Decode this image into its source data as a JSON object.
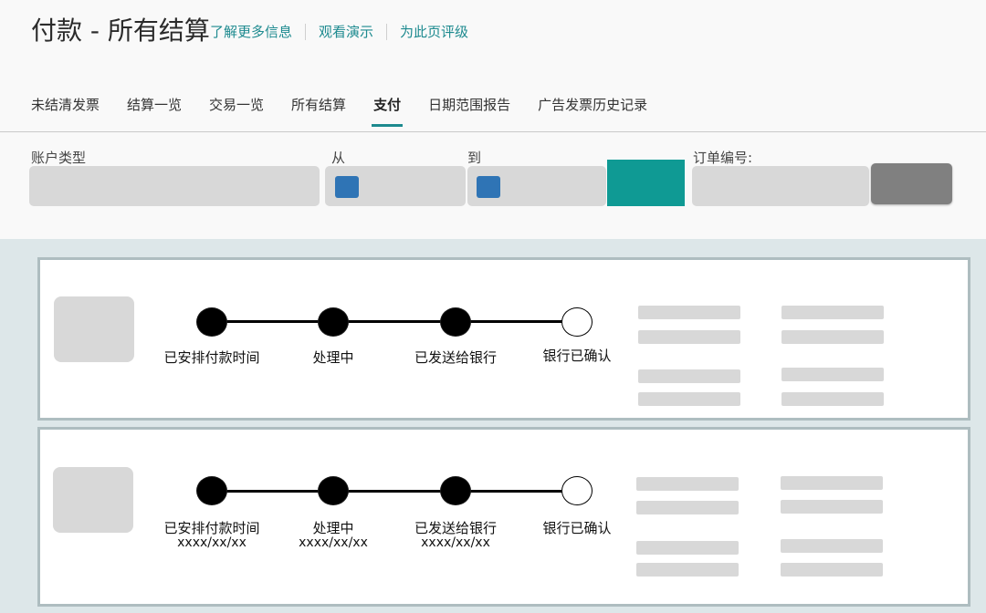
{
  "header": {
    "title": "付款 - 所有结算",
    "links": [
      "了解更多信息",
      "观看演示",
      "为此页评级"
    ]
  },
  "tabs": [
    {
      "label": "未结清发票",
      "active": false
    },
    {
      "label": "结算一览",
      "active": false
    },
    {
      "label": "交易一览",
      "active": false
    },
    {
      "label": "所有结算",
      "active": false
    },
    {
      "label": "支付",
      "active": true
    },
    {
      "label": "日期范围报告",
      "active": false
    },
    {
      "label": "广告发票历史记录",
      "active": false
    }
  ],
  "filters": {
    "account_type_label": "账户类型",
    "from_label": "从",
    "to_label": "到",
    "order_number_label": "订单编号:"
  },
  "colors": {
    "accent": "#1d8a8f",
    "primary_button": "#0f9a94",
    "secondary_button": "#808080",
    "calendar_icon": "#2f74b5"
  },
  "payments": [
    {
      "steps": [
        {
          "label": "已安排付款时间",
          "date": "",
          "completed": true
        },
        {
          "label": "处理中",
          "date": "",
          "completed": true
        },
        {
          "label": "已发送给银行",
          "date": "",
          "completed": true
        },
        {
          "label": "银行已确认",
          "date": "",
          "completed": false
        }
      ]
    },
    {
      "steps": [
        {
          "label": "已安排付款时间",
          "date": "xxxx/xx/xx",
          "completed": true
        },
        {
          "label": "处理中",
          "date": "xxxx/xx/xx",
          "completed": true
        },
        {
          "label": "已发送给银行",
          "date": "xxxx/xx/xx",
          "completed": true
        },
        {
          "label": "银行已确认",
          "date": "",
          "completed": false
        }
      ]
    }
  ]
}
